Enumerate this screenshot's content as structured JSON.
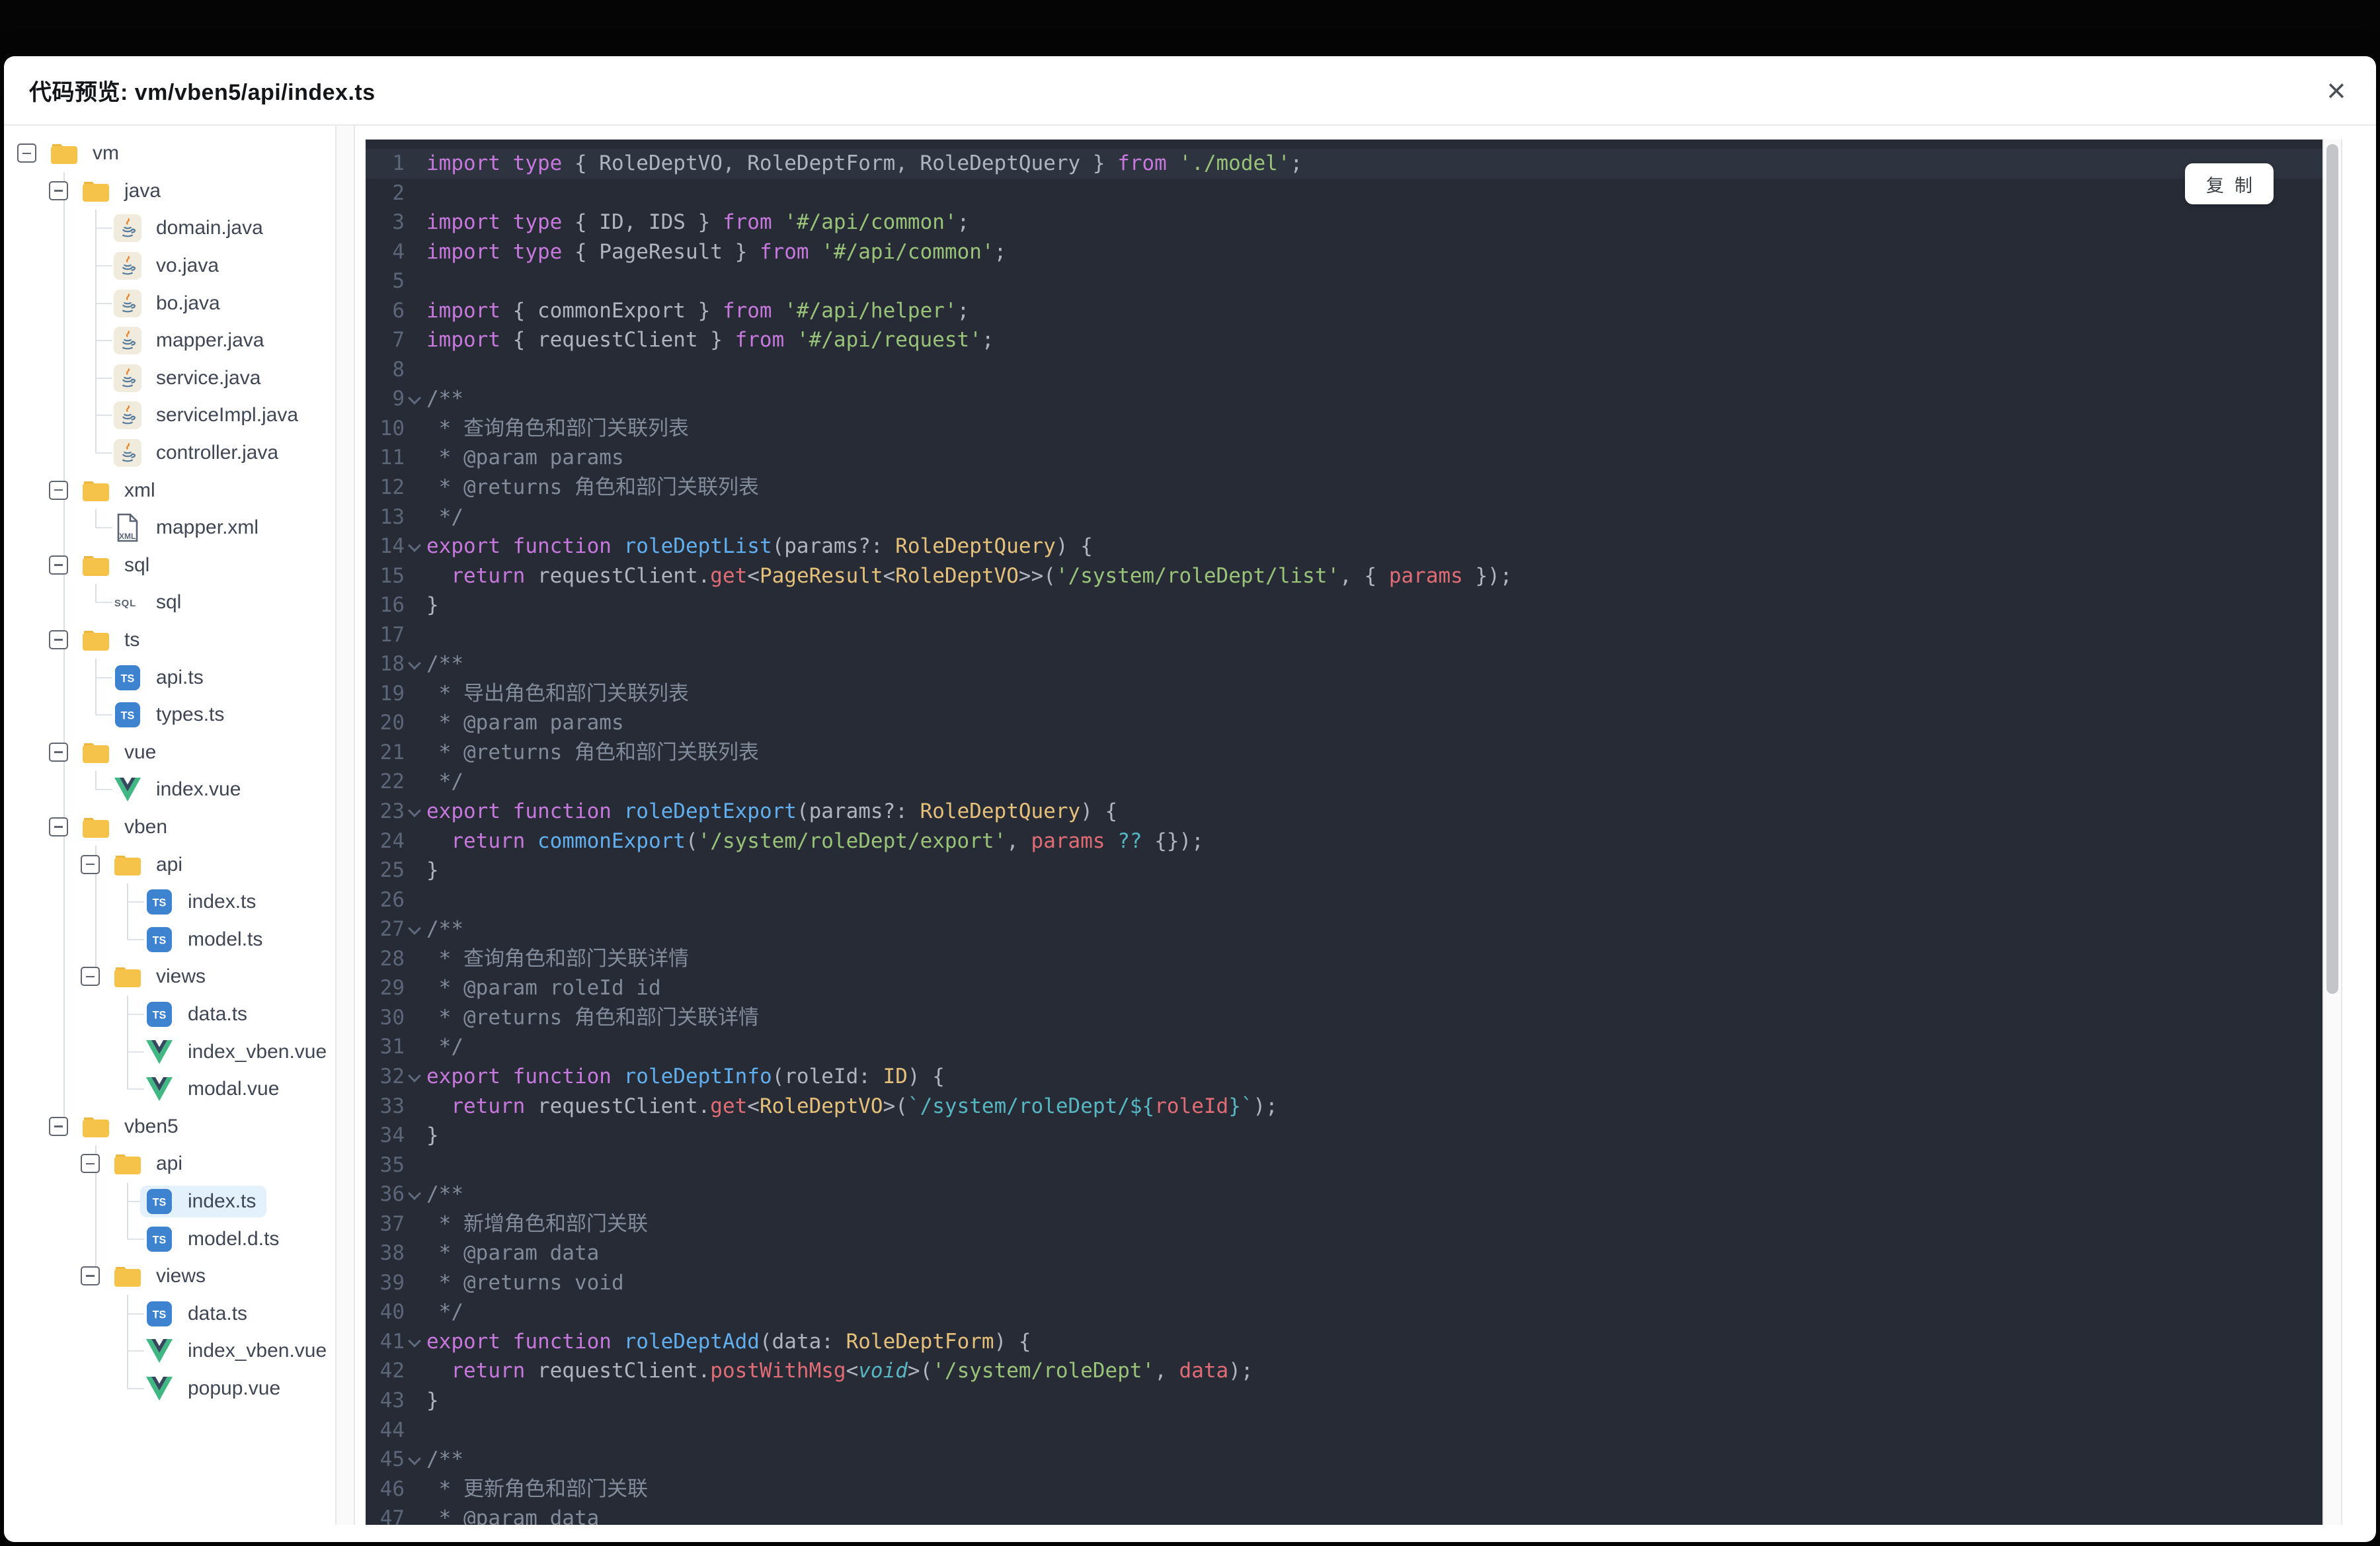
{
  "window": {
    "title": "代码预览: vm/vben5/api/index.ts",
    "close_icon": "×"
  },
  "sidebar": {
    "tree": [
      {
        "label": "vm",
        "depth": 0,
        "icon": "folder",
        "toggle": true
      },
      {
        "label": "java",
        "depth": 1,
        "icon": "folder",
        "toggle": true
      },
      {
        "label": "domain.java",
        "depth": 2,
        "icon": "java"
      },
      {
        "label": "vo.java",
        "depth": 2,
        "icon": "java"
      },
      {
        "label": "bo.java",
        "depth": 2,
        "icon": "java"
      },
      {
        "label": "mapper.java",
        "depth": 2,
        "icon": "java"
      },
      {
        "label": "service.java",
        "depth": 2,
        "icon": "java"
      },
      {
        "label": "serviceImpl.java",
        "depth": 2,
        "icon": "java"
      },
      {
        "label": "controller.java",
        "depth": 2,
        "icon": "java"
      },
      {
        "label": "xml",
        "depth": 1,
        "icon": "folder",
        "toggle": true
      },
      {
        "label": "mapper.xml",
        "depth": 2,
        "icon": "xml"
      },
      {
        "label": "sql",
        "depth": 1,
        "icon": "folder",
        "toggle": true
      },
      {
        "label": "sql",
        "depth": 2,
        "icon": "sql"
      },
      {
        "label": "ts",
        "depth": 1,
        "icon": "folder",
        "toggle": true
      },
      {
        "label": "api.ts",
        "depth": 2,
        "icon": "ts"
      },
      {
        "label": "types.ts",
        "depth": 2,
        "icon": "ts"
      },
      {
        "label": "vue",
        "depth": 1,
        "icon": "folder",
        "toggle": true
      },
      {
        "label": "index.vue",
        "depth": 2,
        "icon": "vue"
      },
      {
        "label": "vben",
        "depth": 1,
        "icon": "folder",
        "toggle": true
      },
      {
        "label": "api",
        "depth": 2,
        "icon": "folder",
        "toggle": true
      },
      {
        "label": "index.ts",
        "depth": 3,
        "icon": "ts"
      },
      {
        "label": "model.ts",
        "depth": 3,
        "icon": "ts"
      },
      {
        "label": "views",
        "depth": 2,
        "icon": "folder",
        "toggle": true
      },
      {
        "label": "data.ts",
        "depth": 3,
        "icon": "ts"
      },
      {
        "label": "index_vben.vue",
        "depth": 3,
        "icon": "vue"
      },
      {
        "label": "modal.vue",
        "depth": 3,
        "icon": "vue"
      },
      {
        "label": "vben5",
        "depth": 1,
        "icon": "folder",
        "toggle": true
      },
      {
        "label": "api",
        "depth": 2,
        "icon": "folder",
        "toggle": true
      },
      {
        "label": "index.ts",
        "depth": 3,
        "icon": "ts",
        "selected": true
      },
      {
        "label": "model.d.ts",
        "depth": 3,
        "icon": "ts"
      },
      {
        "label": "views",
        "depth": 2,
        "icon": "folder",
        "toggle": true
      },
      {
        "label": "data.ts",
        "depth": 3,
        "icon": "ts"
      },
      {
        "label": "index_vben.vue",
        "depth": 3,
        "icon": "vue"
      },
      {
        "label": "popup.vue",
        "depth": 3,
        "icon": "vue"
      }
    ]
  },
  "code": {
    "copy_label": "复制",
    "lines": [
      {
        "n": 1,
        "active": true,
        "t": [
          [
            "k",
            "import"
          ],
          [
            "d",
            " "
          ],
          [
            "k",
            "type"
          ],
          [
            "d",
            " { RoleDeptVO, RoleDeptForm, RoleDeptQuery } "
          ],
          [
            "k",
            "from"
          ],
          [
            "d",
            " "
          ],
          [
            "s",
            "'./model'"
          ],
          [
            "d",
            ";"
          ]
        ]
      },
      {
        "n": 2,
        "t": []
      },
      {
        "n": 3,
        "t": [
          [
            "k",
            "import"
          ],
          [
            "d",
            " "
          ],
          [
            "k",
            "type"
          ],
          [
            "d",
            " { ID, IDS } "
          ],
          [
            "k",
            "from"
          ],
          [
            "d",
            " "
          ],
          [
            "s",
            "'#/api/common'"
          ],
          [
            "d",
            ";"
          ]
        ]
      },
      {
        "n": 4,
        "t": [
          [
            "k",
            "import"
          ],
          [
            "d",
            " "
          ],
          [
            "k",
            "type"
          ],
          [
            "d",
            " { PageResult } "
          ],
          [
            "k",
            "from"
          ],
          [
            "d",
            " "
          ],
          [
            "s",
            "'#/api/common'"
          ],
          [
            "d",
            ";"
          ]
        ]
      },
      {
        "n": 5,
        "t": []
      },
      {
        "n": 6,
        "t": [
          [
            "k",
            "import"
          ],
          [
            "d",
            " { commonExport } "
          ],
          [
            "k",
            "from"
          ],
          [
            "d",
            " "
          ],
          [
            "s",
            "'#/api/helper'"
          ],
          [
            "d",
            ";"
          ]
        ]
      },
      {
        "n": 7,
        "t": [
          [
            "k",
            "import"
          ],
          [
            "d",
            " { requestClient } "
          ],
          [
            "k",
            "from"
          ],
          [
            "d",
            " "
          ],
          [
            "s",
            "'#/api/request'"
          ],
          [
            "d",
            ";"
          ]
        ]
      },
      {
        "n": 8,
        "t": []
      },
      {
        "n": 9,
        "fold": true,
        "t": [
          [
            "c",
            "/**"
          ]
        ]
      },
      {
        "n": 10,
        "t": [
          [
            "c",
            " * 查询角色和部门关联列表"
          ]
        ]
      },
      {
        "n": 11,
        "t": [
          [
            "c",
            " * @param params"
          ]
        ]
      },
      {
        "n": 12,
        "t": [
          [
            "c",
            " * @returns 角色和部门关联列表"
          ]
        ]
      },
      {
        "n": 13,
        "t": [
          [
            "c",
            " */"
          ]
        ]
      },
      {
        "n": 14,
        "fold": true,
        "t": [
          [
            "k",
            "export"
          ],
          [
            "d",
            " "
          ],
          [
            "k",
            "function"
          ],
          [
            "d",
            " "
          ],
          [
            "f",
            "roleDeptList"
          ],
          [
            "d",
            "(params?: "
          ],
          [
            "t",
            "RoleDeptQuery"
          ],
          [
            "d",
            ") {"
          ]
        ]
      },
      {
        "n": 15,
        "t": [
          [
            "d",
            "  "
          ],
          [
            "k",
            "return"
          ],
          [
            "d",
            " requestClient."
          ],
          [
            "p",
            "get"
          ],
          [
            "d",
            "<"
          ],
          [
            "t",
            "PageResult"
          ],
          [
            "d",
            "<"
          ],
          [
            "t",
            "RoleDeptVO"
          ],
          [
            "d",
            ">>("
          ],
          [
            "s",
            "'/system/roleDept/list'"
          ],
          [
            "d",
            ", { "
          ],
          [
            "p",
            "params"
          ],
          [
            "d",
            " });"
          ]
        ]
      },
      {
        "n": 16,
        "t": [
          [
            "d",
            "}"
          ]
        ]
      },
      {
        "n": 17,
        "t": []
      },
      {
        "n": 18,
        "fold": true,
        "t": [
          [
            "c",
            "/**"
          ]
        ]
      },
      {
        "n": 19,
        "t": [
          [
            "c",
            " * 导出角色和部门关联列表"
          ]
        ]
      },
      {
        "n": 20,
        "t": [
          [
            "c",
            " * @param params"
          ]
        ]
      },
      {
        "n": 21,
        "t": [
          [
            "c",
            " * @returns 角色和部门关联列表"
          ]
        ]
      },
      {
        "n": 22,
        "t": [
          [
            "c",
            " */"
          ]
        ]
      },
      {
        "n": 23,
        "fold": true,
        "t": [
          [
            "k",
            "export"
          ],
          [
            "d",
            " "
          ],
          [
            "k",
            "function"
          ],
          [
            "d",
            " "
          ],
          [
            "f",
            "roleDeptExport"
          ],
          [
            "d",
            "(params?: "
          ],
          [
            "t",
            "RoleDeptQuery"
          ],
          [
            "d",
            ") {"
          ]
        ]
      },
      {
        "n": 24,
        "t": [
          [
            "d",
            "  "
          ],
          [
            "k",
            "return"
          ],
          [
            "d",
            " "
          ],
          [
            "f",
            "commonExport"
          ],
          [
            "d",
            "("
          ],
          [
            "s",
            "'/system/roleDept/export'"
          ],
          [
            "d",
            ", "
          ],
          [
            "p",
            "params"
          ],
          [
            "d",
            " "
          ],
          [
            "y",
            "??"
          ],
          [
            "d",
            " {});"
          ]
        ]
      },
      {
        "n": 25,
        "t": [
          [
            "d",
            "}"
          ]
        ]
      },
      {
        "n": 26,
        "t": []
      },
      {
        "n": 27,
        "fold": true,
        "t": [
          [
            "c",
            "/**"
          ]
        ]
      },
      {
        "n": 28,
        "t": [
          [
            "c",
            " * 查询角色和部门关联详情"
          ]
        ]
      },
      {
        "n": 29,
        "t": [
          [
            "c",
            " * @param roleId id"
          ]
        ]
      },
      {
        "n": 30,
        "t": [
          [
            "c",
            " * @returns 角色和部门关联详情"
          ]
        ]
      },
      {
        "n": 31,
        "t": [
          [
            "c",
            " */"
          ]
        ]
      },
      {
        "n": 32,
        "fold": true,
        "t": [
          [
            "k",
            "export"
          ],
          [
            "d",
            " "
          ],
          [
            "k",
            "function"
          ],
          [
            "d",
            " "
          ],
          [
            "f",
            "roleDeptInfo"
          ],
          [
            "d",
            "(roleId: "
          ],
          [
            "t",
            "ID"
          ],
          [
            "d",
            ") {"
          ]
        ]
      },
      {
        "n": 33,
        "t": [
          [
            "d",
            "  "
          ],
          [
            "k",
            "return"
          ],
          [
            "d",
            " requestClient."
          ],
          [
            "p",
            "get"
          ],
          [
            "d",
            "<"
          ],
          [
            "t",
            "RoleDeptVO"
          ],
          [
            "d",
            ">("
          ],
          [
            "y",
            "`/system/roleDept/${"
          ],
          [
            "p",
            "roleId"
          ],
          [
            "y",
            "}`"
          ],
          [
            "d",
            ");"
          ]
        ]
      },
      {
        "n": 34,
        "t": [
          [
            "d",
            "}"
          ]
        ]
      },
      {
        "n": 35,
        "t": []
      },
      {
        "n": 36,
        "fold": true,
        "t": [
          [
            "c",
            "/**"
          ]
        ]
      },
      {
        "n": 37,
        "t": [
          [
            "c",
            " * 新增角色和部门关联"
          ]
        ]
      },
      {
        "n": 38,
        "t": [
          [
            "c",
            " * @param data"
          ]
        ]
      },
      {
        "n": 39,
        "t": [
          [
            "c",
            " * @returns void"
          ]
        ]
      },
      {
        "n": 40,
        "t": [
          [
            "c",
            " */"
          ]
        ]
      },
      {
        "n": 41,
        "fold": true,
        "t": [
          [
            "k",
            "export"
          ],
          [
            "d",
            " "
          ],
          [
            "k",
            "function"
          ],
          [
            "d",
            " "
          ],
          [
            "f",
            "roleDeptAdd"
          ],
          [
            "d",
            "(data: "
          ],
          [
            "t",
            "RoleDeptForm"
          ],
          [
            "d",
            ") {"
          ]
        ]
      },
      {
        "n": 42,
        "t": [
          [
            "d",
            "  "
          ],
          [
            "k",
            "return"
          ],
          [
            "d",
            " requestClient."
          ],
          [
            "p",
            "postWithMsg"
          ],
          [
            "d",
            "<"
          ],
          [
            "yi",
            "void"
          ],
          [
            "d",
            ">("
          ],
          [
            "s",
            "'/system/roleDept'"
          ],
          [
            "d",
            ", "
          ],
          [
            "p",
            "data"
          ],
          [
            "d",
            ");"
          ]
        ]
      },
      {
        "n": 43,
        "t": [
          [
            "d",
            "}"
          ]
        ]
      },
      {
        "n": 44,
        "t": []
      },
      {
        "n": 45,
        "fold": true,
        "t": [
          [
            "c",
            "/**"
          ]
        ]
      },
      {
        "n": 46,
        "t": [
          [
            "c",
            " * 更新角色和部门关联"
          ]
        ]
      },
      {
        "n": 47,
        "t": [
          [
            "c",
            " * @param data"
          ]
        ]
      }
    ]
  },
  "colors": {
    "code_bg": "#272b35",
    "active_line_bg": "#2e3340",
    "keyword": "#c678dd",
    "string": "#98c379",
    "function": "#61afef",
    "type": "#e5c07b",
    "property": "#e06c75",
    "cyan": "#56b6c2",
    "comment": "#828b9a",
    "default_text": "#aeb4c0",
    "line_number": "#5c6679",
    "selected_row_bg": "#e3f1fd",
    "folder_icon": "#f6c34a",
    "ts_badge": "#3d83cf",
    "vue_green": "#41b883",
    "vue_dark": "#34495e"
  }
}
